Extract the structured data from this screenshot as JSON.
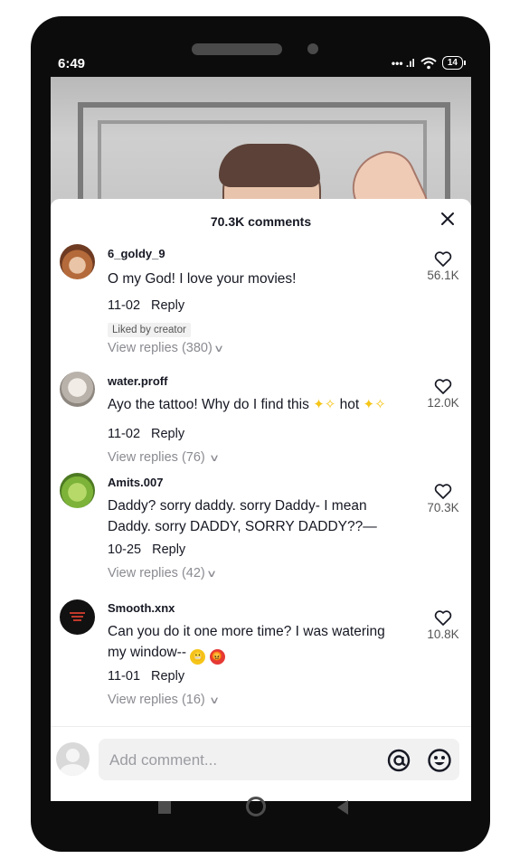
{
  "status": {
    "time": "6:49",
    "signal": "••• .ıl",
    "battery": "14"
  },
  "sheet": {
    "title": "70.3K comments"
  },
  "comments": [
    {
      "username": "6_goldy_9",
      "text": "O my God! I love your movies!",
      "date": "11-02",
      "reply": "Reply",
      "badge": "Liked by creator",
      "view_replies": "View replies (380)",
      "likes": "56.1K"
    },
    {
      "username": "water.proff",
      "text_before": "Ayo the tattoo! Why do I find this",
      "text_mid": "hot",
      "date": "11-02",
      "reply": "Reply",
      "view_replies": "View replies (76)",
      "likes": "12.0K"
    },
    {
      "username": "Amits.007",
      "text": "Daddy? sorry daddy. sorry Daddy- I mean Daddy. sorry DADDY, SORRY DADDY??—",
      "date": "10-25",
      "reply": "Reply",
      "view_replies": "View replies (42)",
      "likes": "70.3K"
    },
    {
      "username": "Smooth.xnx",
      "text": "Can you do it one more time? I was watering my window--",
      "date": "11-01",
      "reply": "Reply",
      "view_replies": "View replies (16)",
      "likes": "10.8K"
    }
  ],
  "input": {
    "placeholder": "Add comment..."
  },
  "colors": {
    "text": "#161823",
    "muted": "#8a8b91",
    "spark": "#f5c518"
  },
  "icons": [
    "close-icon",
    "heart-icon",
    "at-icon",
    "emoji-icon",
    "chevron-down-icon",
    "nav-recents-icon",
    "nav-home-icon",
    "nav-back-icon"
  ]
}
